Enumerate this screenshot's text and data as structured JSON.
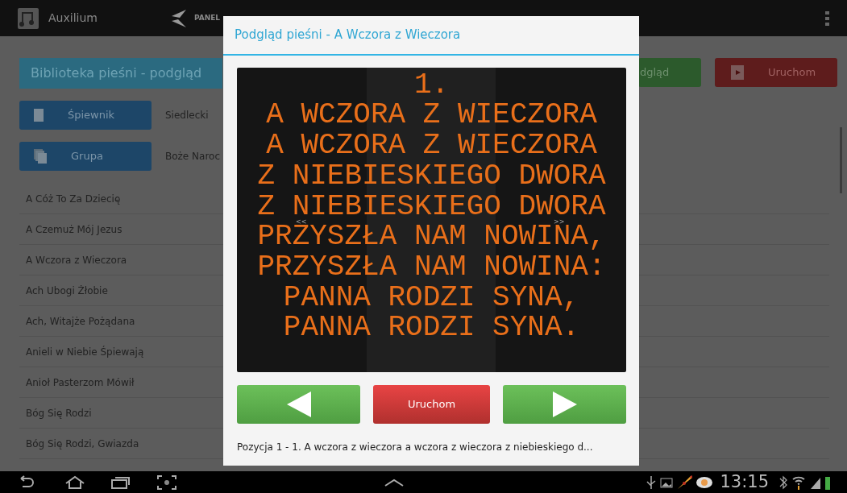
{
  "app_bar": {
    "title": "Auxilium",
    "panel_label": "PANEL"
  },
  "library": {
    "header": "Biblioteka pieśni - podgląd",
    "filters": [
      {
        "kind": "book",
        "button": "Śpiewnik",
        "value": "Siedlecki"
      },
      {
        "kind": "group",
        "button": "Grupa",
        "value": "Boże Naroc"
      }
    ],
    "actions": [
      {
        "kind": "preview",
        "label": "dgląd"
      },
      {
        "kind": "run",
        "label": "Uruchom"
      }
    ],
    "songs": [
      "A Cóż To Za Dziecię",
      "A Czemuż Mój Jezus",
      "A Wczora z Wieczora",
      "Ach Ubogi Żłobie",
      "Ach, Witajże Pożądana",
      "Anieli w Niebie Śpiewają",
      "Anioł Pasterzom Mówił",
      "Bóg Się Rodzi",
      "Bóg Się Rodzi, Gwiazda"
    ]
  },
  "dialog": {
    "title": "Podgląd pieśni - A Wczora z Wieczora",
    "lyrics": [
      "1.",
      "A WCZORA Z WIECZORA",
      "A WCZORA Z WIECZORA",
      "Z NIEBIESKIEGO DWORA",
      "Z NIEBIESKIEGO DWORA",
      "PRZYSZŁA NAM NOWINA,",
      "PRZYSZŁA NAM NOWINA:",
      "PANNA RODZI SYNA,",
      "PANNA RODZI SYNA."
    ],
    "nav_hints": [
      "<<",
      ">>"
    ],
    "buttons": [
      {
        "kind": "prev"
      },
      {
        "kind": "run",
        "label": "Uruchom"
      },
      {
        "kind": "next"
      }
    ],
    "status": "Pozycja 1 - 1. A wczora z wieczora a wczora z wieczora z niebieskiego d..."
  },
  "system_bar": {
    "time": "13:15"
  }
}
